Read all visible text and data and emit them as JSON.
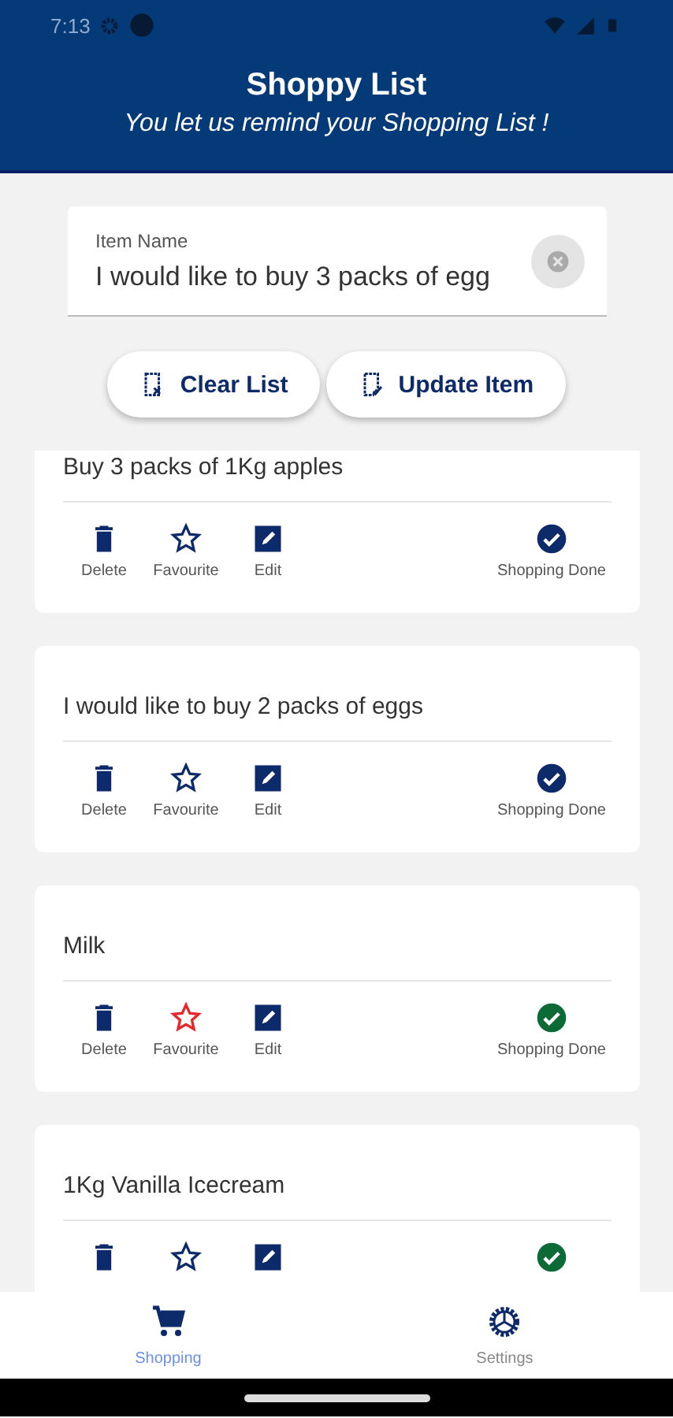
{
  "status_bar": {
    "time": "7:13"
  },
  "header": {
    "title": "Shoppy List",
    "subtitle": "You let us remind your Shopping List !"
  },
  "item_field": {
    "label": "Item Name",
    "value": "I would like to buy 3 packs of egg"
  },
  "buttons": [
    {
      "kind": "clear",
      "label": "Clear List"
    },
    {
      "kind": "update",
      "label": "Update Item"
    }
  ],
  "items": [
    {
      "text": "Buy 3 packs of 1Kg apples",
      "favourite": false,
      "done": false,
      "labels": [
        "Delete",
        "Favourite",
        "Edit",
        "Shopping Done"
      ]
    },
    {
      "text": "I would like to buy 2 packs of eggs",
      "favourite": false,
      "done": false,
      "labels": [
        "Delete",
        "Favourite",
        "Edit",
        "Shopping Done"
      ]
    },
    {
      "text": "Milk",
      "favourite": true,
      "done": true,
      "labels": [
        "Delete",
        "Favourite",
        "Edit",
        "Shopping Done"
      ]
    },
    {
      "text": "1Kg Vanilla Icecream",
      "favourite": false,
      "done": true
    }
  ],
  "bottom_nav": [
    {
      "kind": "cart",
      "label": "Shopping",
      "selected": true
    },
    {
      "kind": "gear",
      "label": "Settings",
      "selected": false
    }
  ]
}
